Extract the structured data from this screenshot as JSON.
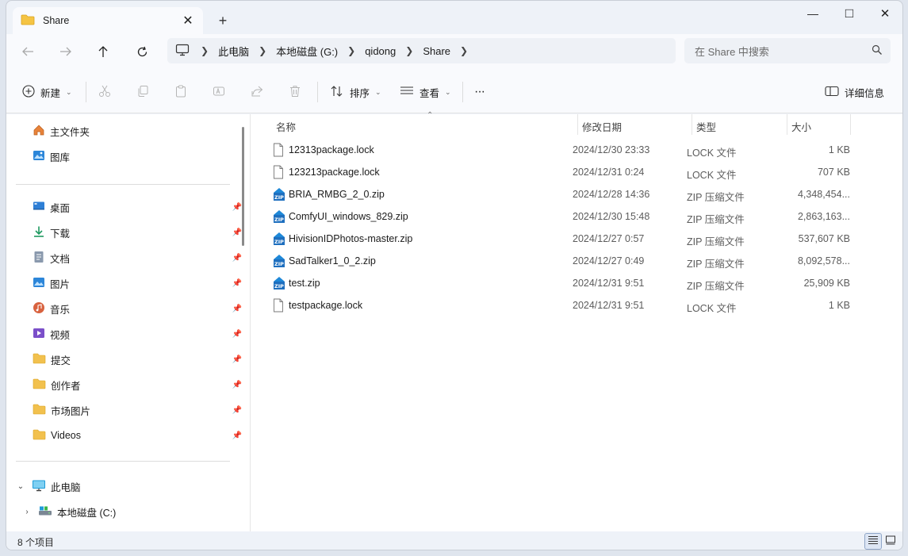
{
  "tab": {
    "title": "Share",
    "close_label": "✕",
    "new_tab_label": "+"
  },
  "window_controls": {
    "minimize": "—",
    "maximize": "□",
    "close": "✕"
  },
  "breadcrumb": [
    "此电脑",
    "本地磁盘 (G:)",
    "qidong",
    "Share"
  ],
  "search": {
    "placeholder": "在 Share 中搜索"
  },
  "toolbar": {
    "new_label": "新建",
    "sort_label": "排序",
    "view_label": "查看",
    "more_label": "···",
    "details_label": "详细信息"
  },
  "sidebar": {
    "top": [
      {
        "label": "主文件夹",
        "icon": "home-icon"
      },
      {
        "label": "图库",
        "icon": "gallery-icon"
      }
    ],
    "quick": [
      {
        "label": "桌面",
        "icon": "desktop-icon",
        "color": "#2e7fd6"
      },
      {
        "label": "下载",
        "icon": "download-icon",
        "color": "#1f9a61"
      },
      {
        "label": "文档",
        "icon": "documents-icon",
        "color": "#6b7c94"
      },
      {
        "label": "图片",
        "icon": "pictures-icon",
        "color": "#2c86d9"
      },
      {
        "label": "音乐",
        "icon": "music-icon",
        "color": "#d8623f"
      },
      {
        "label": "视频",
        "icon": "videos-icon",
        "color": "#7b4fc9"
      },
      {
        "label": "提交",
        "icon": "folder-icon",
        "color": "#f2c14e"
      },
      {
        "label": "创作者",
        "icon": "folder-icon",
        "color": "#f2c14e"
      },
      {
        "label": "市场图片",
        "icon": "folder-icon",
        "color": "#f2c14e"
      },
      {
        "label": "Videos",
        "icon": "folder-icon",
        "color": "#f2c14e"
      }
    ],
    "tree": [
      {
        "label": "此电脑",
        "icon": "pc-icon"
      },
      {
        "label": "本地磁盘 (C:)",
        "icon": "drive-icon"
      }
    ]
  },
  "columns": {
    "name": "名称",
    "date": "修改日期",
    "type": "类型",
    "size": "大小"
  },
  "files": [
    {
      "name": "12313package.lock",
      "date": "2024/12/30 23:33",
      "type": "LOCK 文件",
      "size": "1 KB",
      "icon": "file-icon"
    },
    {
      "name": "123213package.lock",
      "date": "2024/12/31 0:24",
      "type": "LOCK 文件",
      "size": "707 KB",
      "icon": "file-icon"
    },
    {
      "name": "BRIA_RMBG_2_0.zip",
      "date": "2024/12/28 14:36",
      "type": "ZIP 压缩文件",
      "size": "4,348,454...",
      "icon": "zip-icon"
    },
    {
      "name": "ComfyUI_windows_829.zip",
      "date": "2024/12/30 15:48",
      "type": "ZIP 压缩文件",
      "size": "2,863,163...",
      "icon": "zip-icon"
    },
    {
      "name": "HivisionIDPhotos-master.zip",
      "date": "2024/12/27 0:57",
      "type": "ZIP 压缩文件",
      "size": "537,607 KB",
      "icon": "zip-icon"
    },
    {
      "name": "SadTalker1_0_2.zip",
      "date": "2024/12/27 0:49",
      "type": "ZIP 压缩文件",
      "size": "8,092,578...",
      "icon": "zip-icon"
    },
    {
      "name": "test.zip",
      "date": "2024/12/31 9:51",
      "type": "ZIP 压缩文件",
      "size": "25,909 KB",
      "icon": "zip-icon"
    },
    {
      "name": "testpackage.lock",
      "date": "2024/12/31 9:51",
      "type": "LOCK 文件",
      "size": "1 KB",
      "icon": "file-icon"
    }
  ],
  "status": {
    "item_count": "8 个项目"
  }
}
